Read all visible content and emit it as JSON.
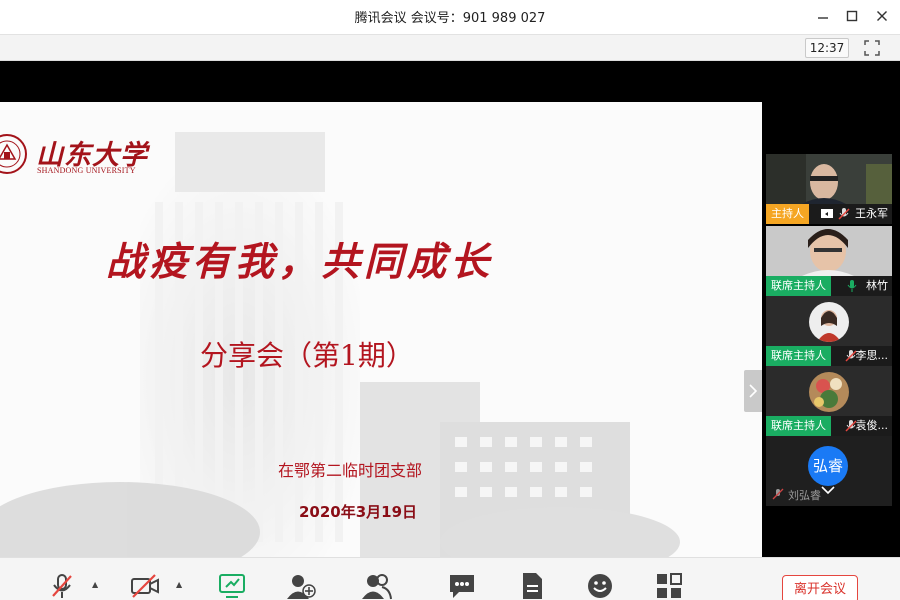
{
  "window": {
    "title": "腾讯会议 会议号：901 989 027"
  },
  "toolbar": {
    "clock": "12:37"
  },
  "slide": {
    "logo_cn": "山东大学",
    "logo_en": "SHANDONG UNIVERSITY",
    "title": "战疫有我，共同成长",
    "subtitle": "分享会（第1期）",
    "organizer": "在鄂第二临时团支部",
    "date": "2020年3月19日"
  },
  "participants": [
    {
      "role": "主持人",
      "name": "王永军",
      "role_color": "#f5a623"
    },
    {
      "role": "联席主持人",
      "name": "林竹",
      "role_color": "#1aad62"
    },
    {
      "role": "联席主持人",
      "name": "李思...",
      "role_color": "#1aad62"
    },
    {
      "role": "联席主持人",
      "name": "袁俊...",
      "role_color": "#1aad62"
    },
    {
      "role": "",
      "name": "刘弘睿",
      "avatar_text": "弘睿",
      "avatar_color": "#1a7af5"
    }
  ],
  "bottom": {
    "leave_label": "离开会议"
  }
}
